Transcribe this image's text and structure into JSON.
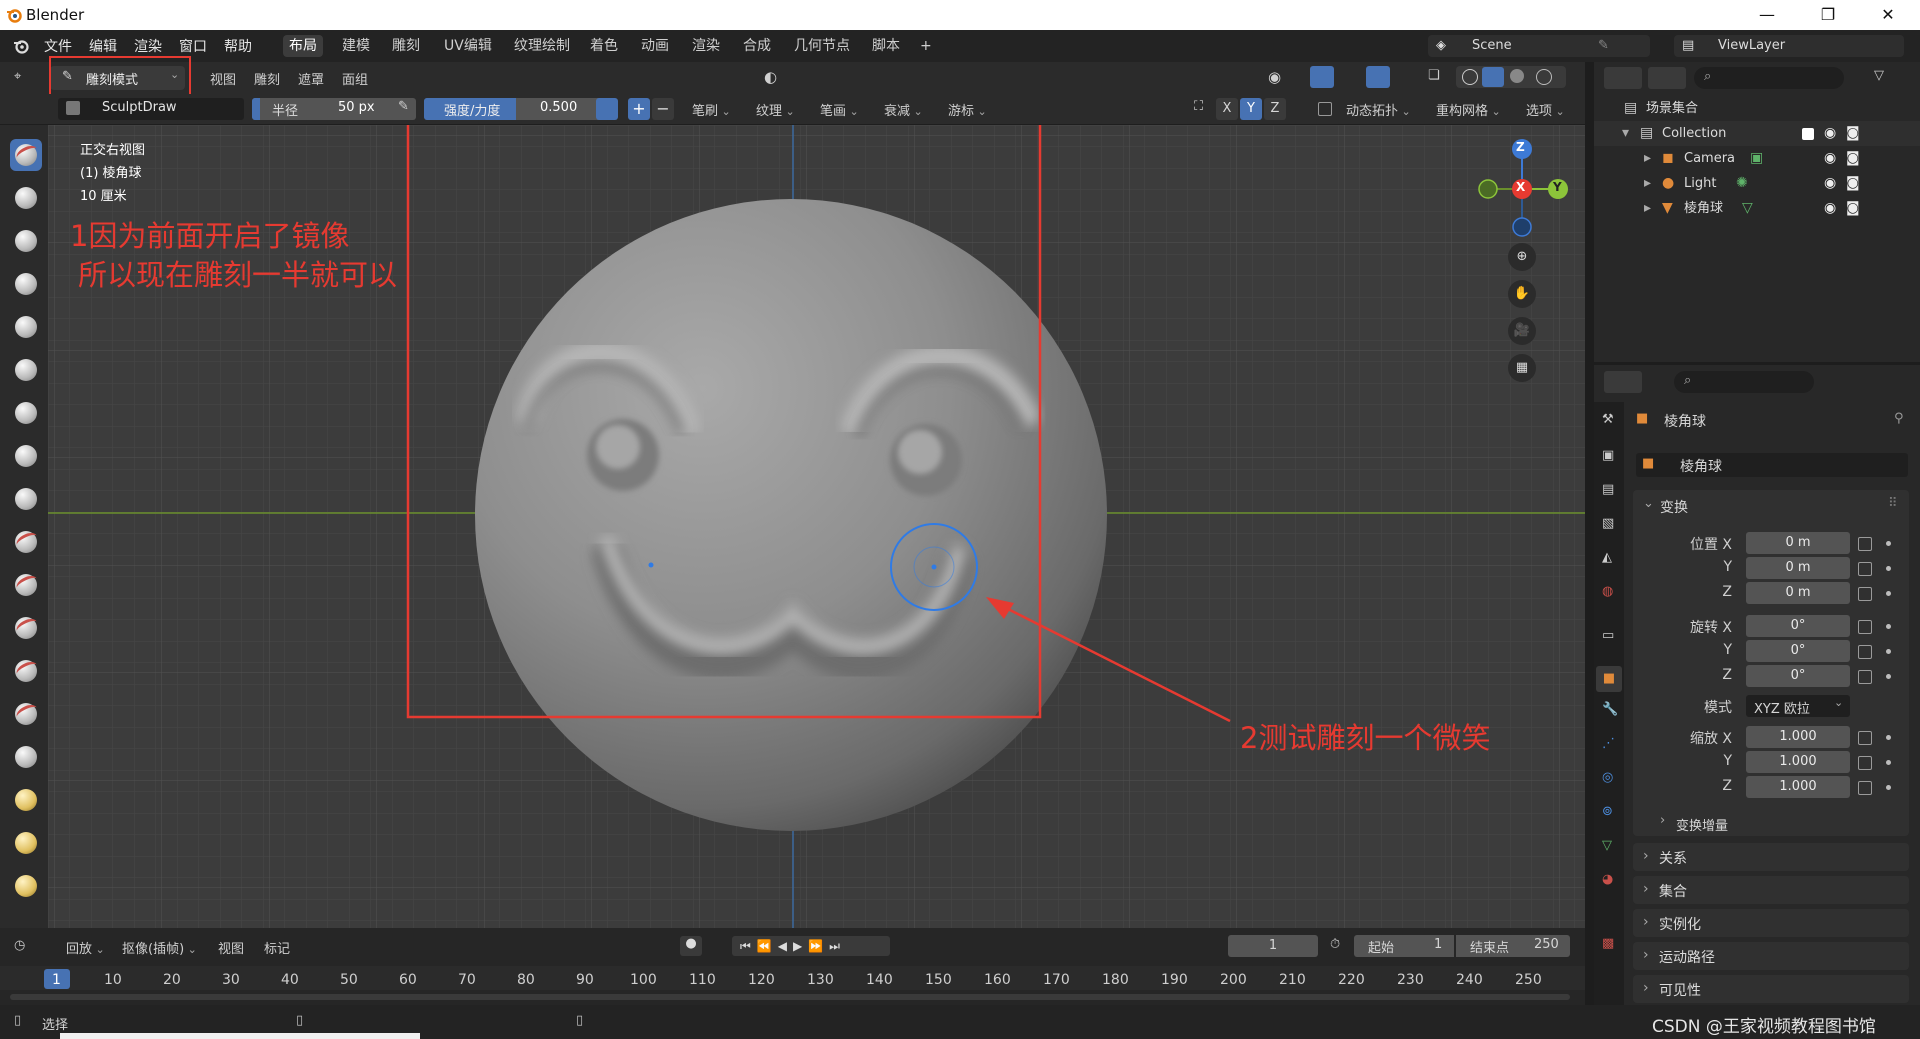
{
  "window": {
    "title": "Blender",
    "minimize": "—",
    "maximize": "❐",
    "close": "✕"
  },
  "menu": [
    "文件",
    "编辑",
    "渲染",
    "窗口",
    "帮助"
  ],
  "workspaces": [
    "布局",
    "建模",
    "雕刻",
    "UV编辑",
    "纹理绘制",
    "着色",
    "动画",
    "渲染",
    "合成",
    "几何节点",
    "脚本",
    "+"
  ],
  "active_workspace": "布局",
  "scene": {
    "name": "Scene",
    "view_layer": "ViewLayer"
  },
  "viewport_header": {
    "mode": "雕刻模式",
    "menus": [
      "视图",
      "雕刻",
      "遮罩",
      "面组"
    ]
  },
  "tool_header": {
    "brush_name": "SculptDraw",
    "radius_label": "半径",
    "radius_value": "50 px",
    "strength_label": "强度/力度",
    "strength_value": "0.500",
    "plus": "+",
    "minus": "−",
    "dropdowns": [
      "笔刷",
      "纹理",
      "笔画",
      "衰减",
      "游标"
    ],
    "axes": [
      "X",
      "Y",
      "Z"
    ],
    "dyntopo": "动态拓扑",
    "remesh": "重构网格",
    "options": "选项"
  },
  "viewport_info": {
    "view_name": "正交右视图",
    "object": "(1) 棱角球",
    "scale": "10 厘米"
  },
  "gizmo": {
    "z": "Z",
    "x": "X",
    "y": "Y"
  },
  "annotations": {
    "note1_line1": "1因为前面开启了镜像",
    "note1_line2": "所以现在雕刻一半就可以",
    "note2": "2测试雕刻一个微笑"
  },
  "outliner": {
    "root": "场景集合",
    "collection": "Collection",
    "items": [
      "Camera",
      "Light",
      "棱角球"
    ]
  },
  "properties": {
    "object_name": "棱角球",
    "datablock": "棱角球",
    "transform_panel": "变换",
    "location_label": "位置 X",
    "rotation_label": "旋转 X",
    "scale_label": "缩放 X",
    "y": "Y",
    "z": "Z",
    "location": [
      "0 m",
      "0 m",
      "0 m"
    ],
    "rotation": [
      "0°",
      "0°",
      "0°"
    ],
    "mode_label": "模式",
    "mode_value": "XYZ 欧拉",
    "scale": [
      "1.000",
      "1.000",
      "1.000"
    ],
    "delta": "变换增量",
    "panels": [
      "关系",
      "集合",
      "实例化",
      "运动路径",
      "可见性"
    ]
  },
  "timeline": {
    "playback": "回放",
    "keying": "抠像(插帧)",
    "view": "视图",
    "marker": "标记",
    "current_frame": "1",
    "start_label": "起始",
    "start": "1",
    "end_label": "结束点",
    "end": "250",
    "ruler": [
      "1",
      "10",
      "20",
      "30",
      "40",
      "50",
      "60",
      "70",
      "80",
      "90",
      "100",
      "110",
      "120",
      "130",
      "140",
      "150",
      "160",
      "170",
      "180",
      "190",
      "200",
      "210",
      "220",
      "230",
      "240",
      "250"
    ]
  },
  "status": {
    "select": "选择",
    "watermark": "CSDN @王家视频教程图书馆"
  },
  "colors": {
    "accent": "#4772b3",
    "annotation_red": "#e63a31",
    "brush_circle": "#2f7be6"
  }
}
